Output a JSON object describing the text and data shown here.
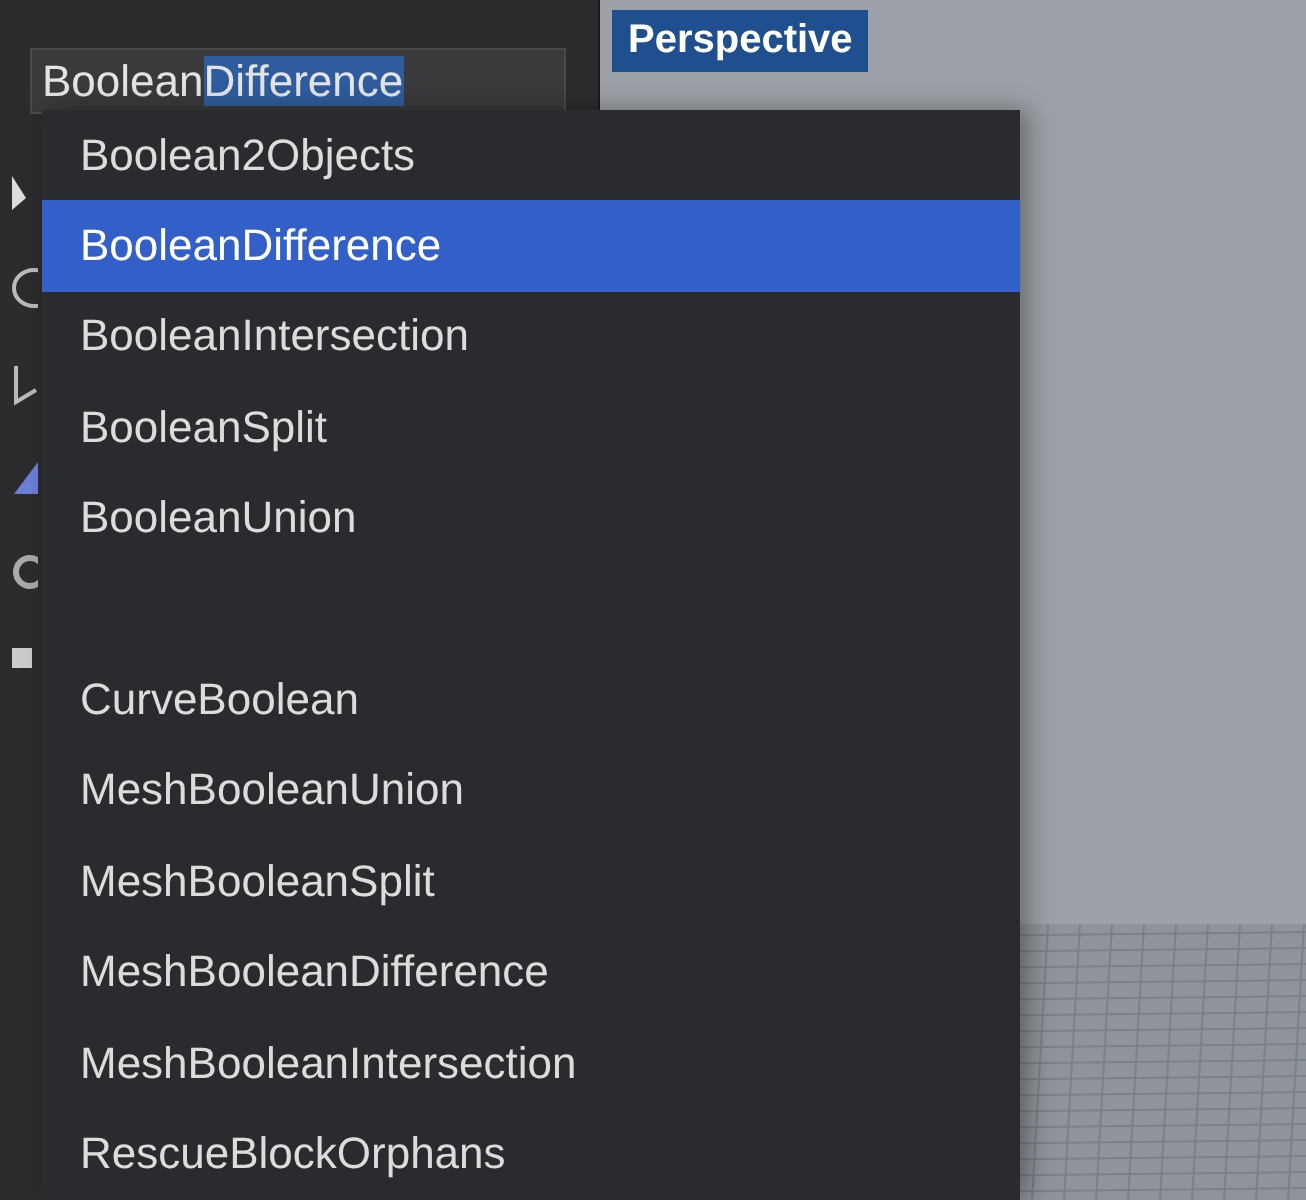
{
  "command_field": {
    "typed": "Boolean",
    "completion": "Difference"
  },
  "viewport": {
    "title": "Perspective"
  },
  "menu": {
    "items": [
      {
        "kind": "command",
        "label": "Boolean2Objects",
        "selected": false
      },
      {
        "kind": "command",
        "label": "BooleanDifference",
        "selected": true
      },
      {
        "kind": "command",
        "label": "BooleanIntersection",
        "selected": false
      },
      {
        "kind": "command",
        "label": "BooleanSplit",
        "selected": false
      },
      {
        "kind": "command",
        "label": "BooleanUnion",
        "selected": false
      },
      {
        "kind": "blank"
      },
      {
        "kind": "command",
        "label": "CurveBoolean",
        "selected": false
      },
      {
        "kind": "command",
        "label": "MeshBooleanUnion",
        "selected": false
      },
      {
        "kind": "command",
        "label": "MeshBooleanSplit",
        "selected": false
      },
      {
        "kind": "command",
        "label": "MeshBooleanDifference",
        "selected": false
      },
      {
        "kind": "command",
        "label": "MeshBooleanIntersection",
        "selected": false
      },
      {
        "kind": "command",
        "label": "RescueBlockOrphans",
        "selected": false
      }
    ]
  }
}
